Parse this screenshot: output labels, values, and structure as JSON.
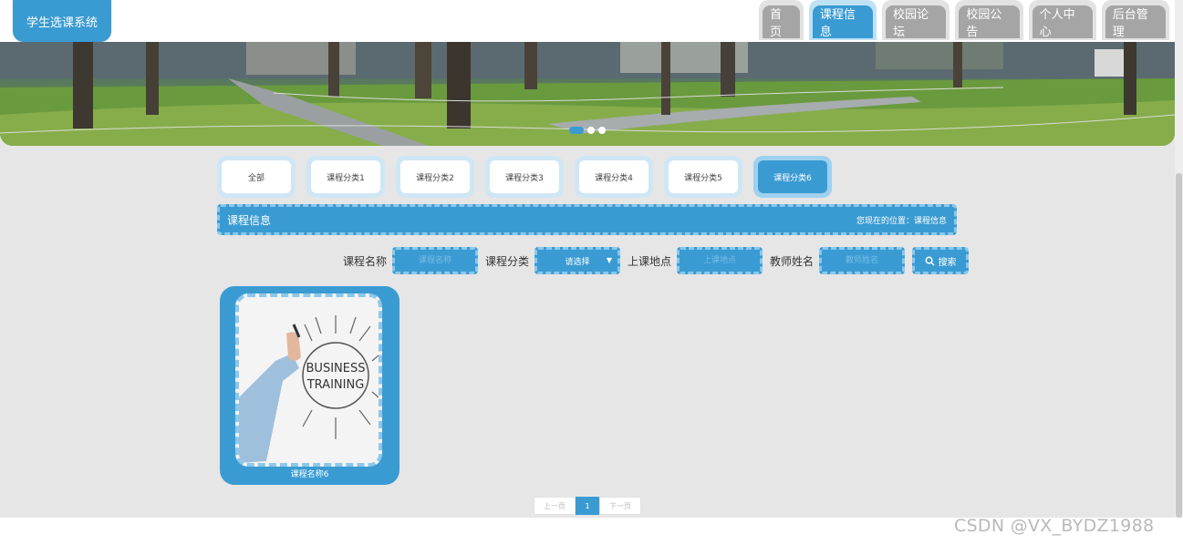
{
  "header": {
    "logo": "学生选课系统",
    "nav": [
      {
        "label": "首页",
        "active": false
      },
      {
        "label": "课程信息",
        "active": true
      },
      {
        "label": "校园论坛",
        "active": false
      },
      {
        "label": "校园公告",
        "active": false
      },
      {
        "label": "个人中心",
        "active": false
      },
      {
        "label": "后台管理",
        "active": false
      }
    ]
  },
  "banner": {
    "slides": 3,
    "active_slide": 1
  },
  "categories": [
    {
      "label": "全部",
      "active": false
    },
    {
      "label": "课程分类1",
      "active": false
    },
    {
      "label": "课程分类2",
      "active": false
    },
    {
      "label": "课程分类3",
      "active": false
    },
    {
      "label": "课程分类4",
      "active": false
    },
    {
      "label": "课程分类5",
      "active": false
    },
    {
      "label": "课程分类6",
      "active": true
    }
  ],
  "section": {
    "title": "课程信息",
    "breadcrumb": "您现在的位置：课程信息"
  },
  "search": {
    "course_name_label": "课程名称",
    "course_name_placeholder": "课程名称",
    "category_label": "课程分类",
    "category_selected": "请选择",
    "location_label": "上课地点",
    "location_placeholder": "上课地点",
    "teacher_label": "教师姓名",
    "teacher_placeholder": "教师姓名",
    "button": "搜索"
  },
  "courses": [
    {
      "name": "课程名称6",
      "image_text": [
        "BUSINESS",
        "TRAINING"
      ]
    }
  ],
  "pagination": {
    "prev": "上一页",
    "current": "1",
    "next": "下一页"
  },
  "watermark": "CSDN @VX_BYDZ1988",
  "colors": {
    "accent": "#3a9bd3",
    "accent_light": "#8cc8ea",
    "background": "#e6e6e6"
  }
}
